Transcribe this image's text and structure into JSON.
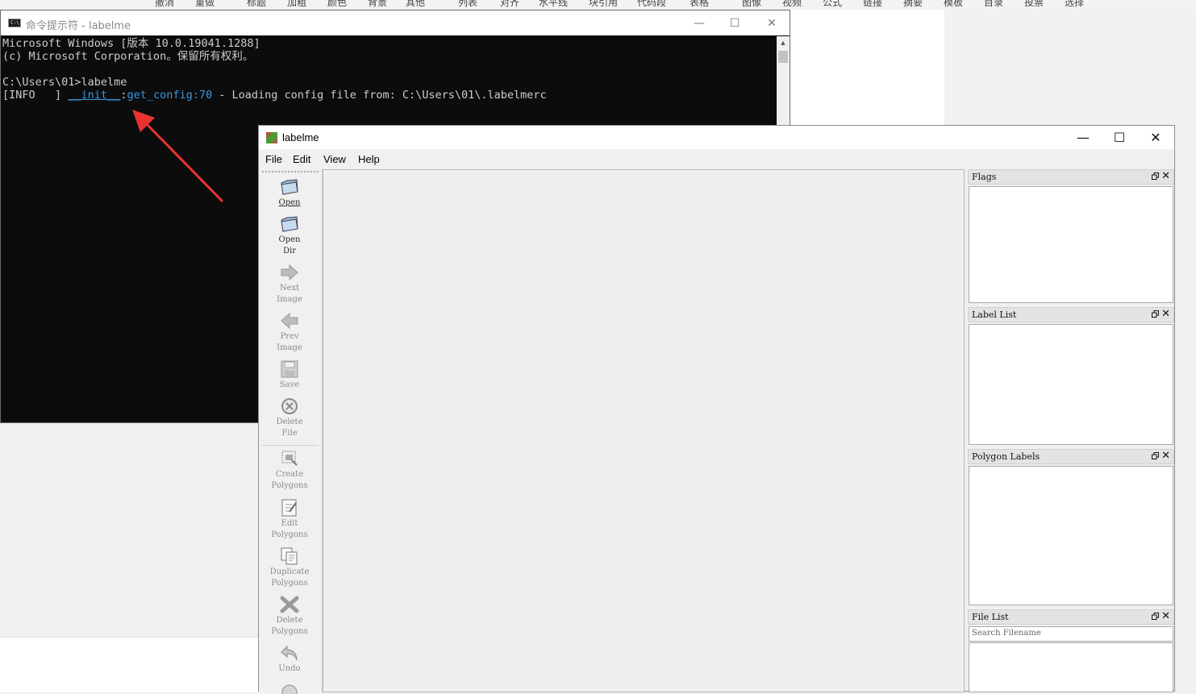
{
  "background_editor": {
    "ribbon_items": [
      "撤消",
      "重做",
      "标题",
      "加粗",
      "颜色",
      "背景",
      "其他",
      "列表",
      "对齐",
      "水平线",
      "块引用",
      "代码段",
      "表格",
      "图像",
      "视频",
      "公式",
      "链接",
      "摘要",
      "模板",
      "目录",
      "投票",
      "选择"
    ]
  },
  "cmd": {
    "title": "命令提示符 - labelme",
    "icon": "cmd-icon",
    "lines": {
      "l1": "Microsoft Windows [版本 10.0.19041.1288]",
      "l2": "(c) Microsoft Corporation。保留所有权利。",
      "l3": "C:\\Users\\01>labelme",
      "l4_prefix": "[INFO   ] ",
      "l4_module": "__init__",
      "l4_colon": ":",
      "l4_func": "get_config",
      "l4_lineno": ":70",
      "l4_msg": " - Loading config file from: C:\\Users\\01\\.labelmerc"
    }
  },
  "annotation": {
    "arrow_color": "#e8332e"
  },
  "labelme": {
    "title": "labelme",
    "menu": [
      "File",
      "Edit",
      "View",
      "Help"
    ],
    "toolbar": [
      {
        "label": "Open",
        "icon": "folder-open-icon",
        "enabled": true
      },
      {
        "label": "Open\nDir",
        "icon": "folder-open-icon",
        "enabled": true
      },
      {
        "label": "Next\nImage",
        "icon": "arrow-right-icon",
        "enabled": false
      },
      {
        "label": "Prev\nImage",
        "icon": "arrow-left-icon",
        "enabled": false
      },
      {
        "label": "Save",
        "icon": "floppy-icon",
        "enabled": false
      },
      {
        "label": "Delete\nFile",
        "icon": "delete-circle-icon",
        "enabled": false
      },
      {
        "label": "Create\nPolygons",
        "icon": "create-polygon-icon",
        "enabled": false
      },
      {
        "label": "Edit\nPolygons",
        "icon": "edit-polygon-icon",
        "enabled": false
      },
      {
        "label": "Duplicate\nPolygons",
        "icon": "duplicate-icon",
        "enabled": false
      },
      {
        "label": "Delete\nPolygons",
        "icon": "delete-x-icon",
        "enabled": false
      },
      {
        "label": "Undo",
        "icon": "undo-icon",
        "enabled": false
      }
    ],
    "docks": {
      "flags": "Flags",
      "label_list": "Label List",
      "polygon_labels": "Polygon Labels",
      "file_list": "File List",
      "file_search_placeholder": "Search Filename"
    }
  }
}
